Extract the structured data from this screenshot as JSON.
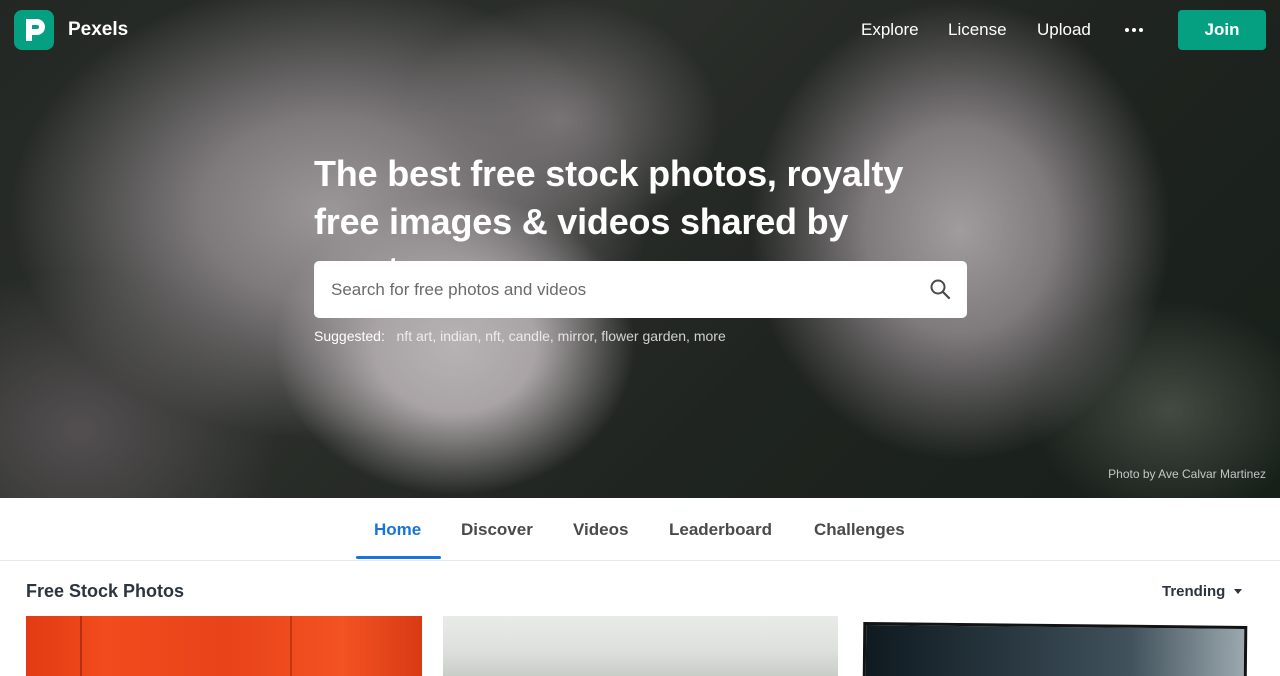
{
  "header": {
    "logo_letter": "P",
    "brand": "Pexels",
    "nav": [
      {
        "label": "Explore"
      },
      {
        "label": "License"
      },
      {
        "label": "Upload"
      }
    ],
    "more_icon": "more-horizontal-icon",
    "join_label": "Join"
  },
  "hero": {
    "title": "The best free stock photos, royalty free images & videos shared by creators.",
    "search": {
      "placeholder": "Search for free photos and videos",
      "value": "",
      "icon": "search-icon"
    },
    "suggested_label": "Suggested:",
    "suggestions": [
      "nft art",
      "indian",
      "nft",
      "candle",
      "mirror",
      "flower garden",
      "more"
    ],
    "credit": "Photo by Ave Calvar Martinez"
  },
  "tabs": [
    {
      "label": "Home",
      "active": true
    },
    {
      "label": "Discover",
      "active": false
    },
    {
      "label": "Videos",
      "active": false
    },
    {
      "label": "Leaderboard",
      "active": false
    },
    {
      "label": "Challenges",
      "active": false
    }
  ],
  "section": {
    "title": "Free Stock Photos",
    "sort": "Trending"
  },
  "colors": {
    "brand": "#05a081",
    "active_tab": "#1a73d9",
    "text_dark": "#2c343e"
  }
}
